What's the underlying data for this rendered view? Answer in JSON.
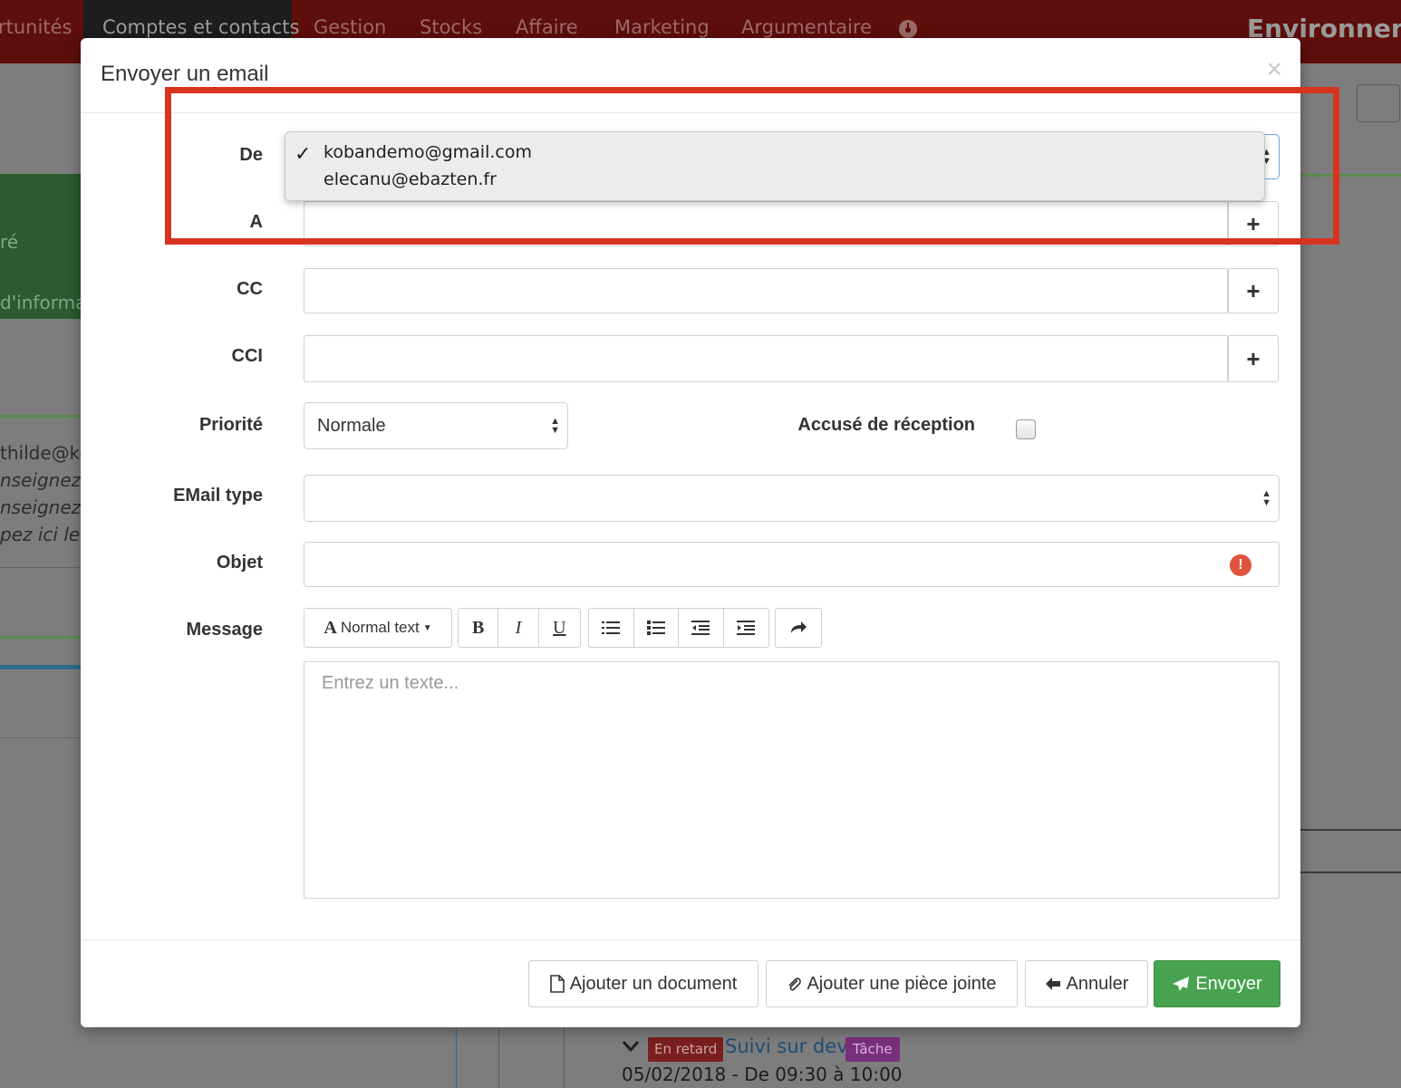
{
  "topnav": {
    "items": [
      "rtunités",
      "Comptes et contacts",
      "Gestion",
      "Stocks",
      "Affaire",
      "Marketing",
      "Argumentaire"
    ],
    "active_index": 1,
    "right_title": "Environneme"
  },
  "background": {
    "left_texts": [
      "ré",
      "d'informa",
      "thilde@ko",
      "nseignez l",
      "nseignez l",
      "pez ici le si"
    ],
    "task": {
      "badge_late": "En retard",
      "title": "Suivi sur devis",
      "badge_type": "Tâche",
      "date": "05/02/2018 - De 09:30 à 10:00"
    }
  },
  "modal": {
    "title": "Envoyer un email",
    "close": "×",
    "fields": {
      "from_label": "De",
      "to_label": "A",
      "cc_label": "CC",
      "cci_label": "CCI",
      "priority_label": "Priorité",
      "priority_value": "Normale",
      "receipt_label": "Accusé de réception",
      "receipt_checked": false,
      "email_type_label": "EMail type",
      "email_type_value": "",
      "subject_label": "Objet",
      "message_label": "Message",
      "message_placeholder": "Entrez un texte..."
    },
    "from_options": [
      "kobandemo@gmail.com",
      "elecanu@ebazten.fr"
    ],
    "from_selected_index": 0,
    "add_symbol": "+",
    "toolbar": {
      "text_style": "Normal text",
      "bold": "B",
      "italic": "I",
      "underline": "U"
    },
    "buttons": {
      "add_document": "Ajouter un document",
      "add_attachment": "Ajouter une pièce jointe",
      "cancel": "Annuler",
      "send": "Envoyer"
    }
  },
  "colors": {
    "nav_bg": "#5e0e0b",
    "highlight": "#d7331f",
    "send_green": "#47a34f",
    "error_red": "#e0533d"
  }
}
